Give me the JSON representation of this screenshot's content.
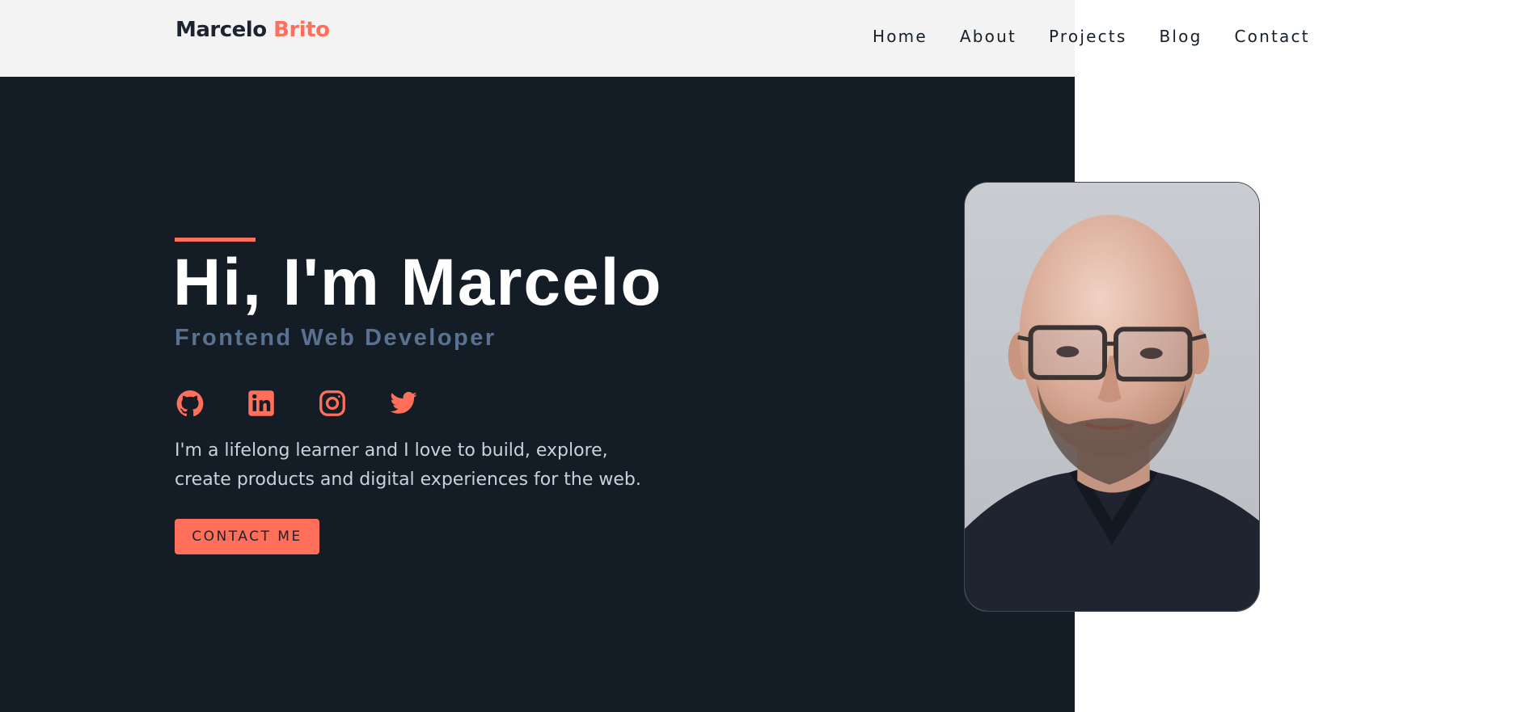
{
  "header": {
    "logo_first": "Marcelo",
    "logo_last": "Brito",
    "nav": [
      "Home",
      "About",
      "Projects",
      "Blog",
      "Contact"
    ]
  },
  "hero": {
    "title": "Hi, I'm Marcelo",
    "subtitle": "Frontend Web Developer",
    "socials": [
      "github-icon",
      "linkedin-icon",
      "instagram-icon",
      "twitter-icon"
    ],
    "bio_line1": "I'm a lifelong learner and I love to build, explore,",
    "bio_line2": "create products and digital experiences for the web.",
    "cta_label": "CONTACT ME"
  },
  "colors": {
    "accent": "#ff6f59",
    "hero_bg": "#141d25",
    "header_bg": "#f3f3f3",
    "subtitle": "#5a7290"
  }
}
